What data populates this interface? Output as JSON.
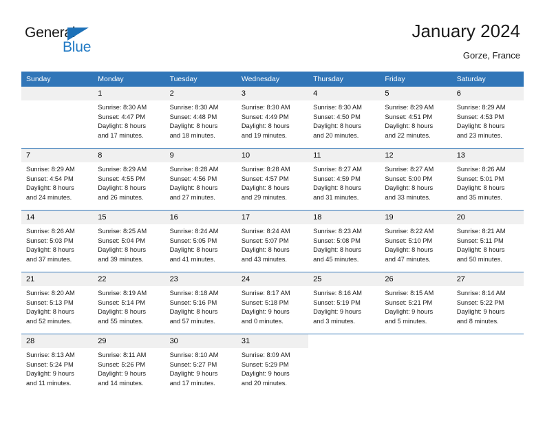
{
  "brand": {
    "name_part1": "General",
    "name_part2": "Blue",
    "accent_color": "#2079c4"
  },
  "header": {
    "title": "January 2024",
    "subtitle": "Gorze, France",
    "header_bg": "#3176b8"
  },
  "weekdays": [
    "Sunday",
    "Monday",
    "Tuesday",
    "Wednesday",
    "Thursday",
    "Friday",
    "Saturday"
  ],
  "weeks": [
    [
      {
        "day": "",
        "lines": [
          "",
          "",
          "",
          ""
        ],
        "empty": true
      },
      {
        "day": "1",
        "lines": [
          "Sunrise: 8:30 AM",
          "Sunset: 4:47 PM",
          "Daylight: 8 hours",
          "and 17 minutes."
        ]
      },
      {
        "day": "2",
        "lines": [
          "Sunrise: 8:30 AM",
          "Sunset: 4:48 PM",
          "Daylight: 8 hours",
          "and 18 minutes."
        ]
      },
      {
        "day": "3",
        "lines": [
          "Sunrise: 8:30 AM",
          "Sunset: 4:49 PM",
          "Daylight: 8 hours",
          "and 19 minutes."
        ]
      },
      {
        "day": "4",
        "lines": [
          "Sunrise: 8:30 AM",
          "Sunset: 4:50 PM",
          "Daylight: 8 hours",
          "and 20 minutes."
        ]
      },
      {
        "day": "5",
        "lines": [
          "Sunrise: 8:29 AM",
          "Sunset: 4:51 PM",
          "Daylight: 8 hours",
          "and 22 minutes."
        ]
      },
      {
        "day": "6",
        "lines": [
          "Sunrise: 8:29 AM",
          "Sunset: 4:53 PM",
          "Daylight: 8 hours",
          "and 23 minutes."
        ]
      }
    ],
    [
      {
        "day": "7",
        "lines": [
          "Sunrise: 8:29 AM",
          "Sunset: 4:54 PM",
          "Daylight: 8 hours",
          "and 24 minutes."
        ]
      },
      {
        "day": "8",
        "lines": [
          "Sunrise: 8:29 AM",
          "Sunset: 4:55 PM",
          "Daylight: 8 hours",
          "and 26 minutes."
        ]
      },
      {
        "day": "9",
        "lines": [
          "Sunrise: 8:28 AM",
          "Sunset: 4:56 PM",
          "Daylight: 8 hours",
          "and 27 minutes."
        ]
      },
      {
        "day": "10",
        "lines": [
          "Sunrise: 8:28 AM",
          "Sunset: 4:57 PM",
          "Daylight: 8 hours",
          "and 29 minutes."
        ]
      },
      {
        "day": "11",
        "lines": [
          "Sunrise: 8:27 AM",
          "Sunset: 4:59 PM",
          "Daylight: 8 hours",
          "and 31 minutes."
        ]
      },
      {
        "day": "12",
        "lines": [
          "Sunrise: 8:27 AM",
          "Sunset: 5:00 PM",
          "Daylight: 8 hours",
          "and 33 minutes."
        ]
      },
      {
        "day": "13",
        "lines": [
          "Sunrise: 8:26 AM",
          "Sunset: 5:01 PM",
          "Daylight: 8 hours",
          "and 35 minutes."
        ]
      }
    ],
    [
      {
        "day": "14",
        "lines": [
          "Sunrise: 8:26 AM",
          "Sunset: 5:03 PM",
          "Daylight: 8 hours",
          "and 37 minutes."
        ]
      },
      {
        "day": "15",
        "lines": [
          "Sunrise: 8:25 AM",
          "Sunset: 5:04 PM",
          "Daylight: 8 hours",
          "and 39 minutes."
        ]
      },
      {
        "day": "16",
        "lines": [
          "Sunrise: 8:24 AM",
          "Sunset: 5:05 PM",
          "Daylight: 8 hours",
          "and 41 minutes."
        ]
      },
      {
        "day": "17",
        "lines": [
          "Sunrise: 8:24 AM",
          "Sunset: 5:07 PM",
          "Daylight: 8 hours",
          "and 43 minutes."
        ]
      },
      {
        "day": "18",
        "lines": [
          "Sunrise: 8:23 AM",
          "Sunset: 5:08 PM",
          "Daylight: 8 hours",
          "and 45 minutes."
        ]
      },
      {
        "day": "19",
        "lines": [
          "Sunrise: 8:22 AM",
          "Sunset: 5:10 PM",
          "Daylight: 8 hours",
          "and 47 minutes."
        ]
      },
      {
        "day": "20",
        "lines": [
          "Sunrise: 8:21 AM",
          "Sunset: 5:11 PM",
          "Daylight: 8 hours",
          "and 50 minutes."
        ]
      }
    ],
    [
      {
        "day": "21",
        "lines": [
          "Sunrise: 8:20 AM",
          "Sunset: 5:13 PM",
          "Daylight: 8 hours",
          "and 52 minutes."
        ]
      },
      {
        "day": "22",
        "lines": [
          "Sunrise: 8:19 AM",
          "Sunset: 5:14 PM",
          "Daylight: 8 hours",
          "and 55 minutes."
        ]
      },
      {
        "day": "23",
        "lines": [
          "Sunrise: 8:18 AM",
          "Sunset: 5:16 PM",
          "Daylight: 8 hours",
          "and 57 minutes."
        ]
      },
      {
        "day": "24",
        "lines": [
          "Sunrise: 8:17 AM",
          "Sunset: 5:18 PM",
          "Daylight: 9 hours",
          "and 0 minutes."
        ]
      },
      {
        "day": "25",
        "lines": [
          "Sunrise: 8:16 AM",
          "Sunset: 5:19 PM",
          "Daylight: 9 hours",
          "and 3 minutes."
        ]
      },
      {
        "day": "26",
        "lines": [
          "Sunrise: 8:15 AM",
          "Sunset: 5:21 PM",
          "Daylight: 9 hours",
          "and 5 minutes."
        ]
      },
      {
        "day": "27",
        "lines": [
          "Sunrise: 8:14 AM",
          "Sunset: 5:22 PM",
          "Daylight: 9 hours",
          "and 8 minutes."
        ]
      }
    ],
    [
      {
        "day": "28",
        "lines": [
          "Sunrise: 8:13 AM",
          "Sunset: 5:24 PM",
          "Daylight: 9 hours",
          "and 11 minutes."
        ]
      },
      {
        "day": "29",
        "lines": [
          "Sunrise: 8:11 AM",
          "Sunset: 5:26 PM",
          "Daylight: 9 hours",
          "and 14 minutes."
        ]
      },
      {
        "day": "30",
        "lines": [
          "Sunrise: 8:10 AM",
          "Sunset: 5:27 PM",
          "Daylight: 9 hours",
          "and 17 minutes."
        ]
      },
      {
        "day": "31",
        "lines": [
          "Sunrise: 8:09 AM",
          "Sunset: 5:29 PM",
          "Daylight: 9 hours",
          "and 20 minutes."
        ]
      },
      {
        "day": "",
        "lines": [
          "",
          "",
          "",
          ""
        ],
        "blank": true
      },
      {
        "day": "",
        "lines": [
          "",
          "",
          "",
          ""
        ],
        "blank": true
      },
      {
        "day": "",
        "lines": [
          "",
          "",
          "",
          ""
        ],
        "blank": true
      }
    ]
  ]
}
